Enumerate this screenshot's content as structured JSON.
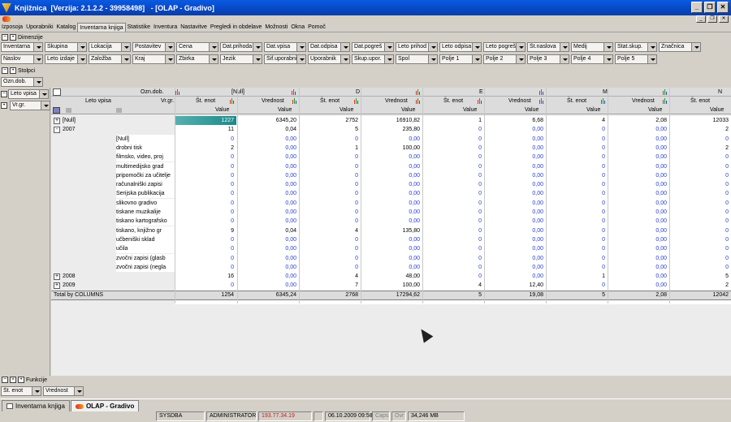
{
  "window": {
    "title": "Knjižnica  [Verzija: 2.1.2.2 - 39958498]   - [OLAP - Gradivo]"
  },
  "menu": [
    "Izposoja",
    "Uporabniki",
    "Katalog",
    "Inventarna knjiga",
    "Statistike",
    "Inventura",
    "Nastavitve",
    "Pregledi in obdelave",
    "Možnosti",
    "Okna",
    "Pomoč"
  ],
  "menu_active": 3,
  "sections": {
    "dimensions": "Dimenzije",
    "columns": "Stolpci",
    "functions": "Funkcije"
  },
  "dimension_row1": [
    "Inventarna",
    "Skupina",
    "Lokacija",
    "Postavitev",
    "Cena",
    "Dat.prihoda",
    "Dat.vpisa",
    "Dat.odpisa",
    "Dat.pogreš",
    "Leto prihod",
    "Leto odpisa",
    "Leto pogreš",
    "Št.naslova",
    "Medij",
    "Stat.skup.",
    "Značnica"
  ],
  "dimension_row2": [
    "Naslov",
    "Leto izdaje",
    "Založba",
    "Kraj",
    "Zbirka",
    "Jezik",
    "Šif.uporabni",
    "Uporabnik",
    "Skup.upor.",
    "Spol",
    "Polje 1",
    "Polje 2",
    "Polje 3",
    "Polje 4",
    "Polje 5"
  ],
  "column_field": "Ozn.dob.",
  "row_fields": [
    "Leto vpisa",
    "Vr.gr."
  ],
  "grid": {
    "col_dim_label": "Ozn.dob.",
    "row_head_1": "Leto vpisa",
    "row_head_2": "Vr.gr.",
    "groups": [
      "[Null]",
      "D",
      "E",
      "M",
      "N"
    ],
    "measures": [
      "Št. enot",
      "Vrednost"
    ],
    "value_label": "Value",
    "rows": [
      {
        "l1": "[Null]",
        "l2": "",
        "exp": "+",
        "v": [
          "1227",
          "6345,20",
          "2752",
          "16910,82",
          "1",
          "6,68",
          "4",
          "2,08",
          "12033"
        ]
      },
      {
        "l1": "2007",
        "l2": "",
        "exp": "-",
        "v": [
          "11",
          "0,04",
          "5",
          "235,80",
          "0",
          "0,00",
          "0",
          "0,00",
          "2"
        ]
      },
      {
        "l1": "",
        "l2": "[Null]",
        "v": [
          "0",
          "0,00",
          "0",
          "0,00",
          "0",
          "0,00",
          "0",
          "0,00",
          "0"
        ]
      },
      {
        "l1": "",
        "l2": "drobni tisk",
        "v": [
          "2",
          "0,00",
          "1",
          "100,00",
          "0",
          "0,00",
          "0",
          "0,00",
          "2"
        ]
      },
      {
        "l1": "",
        "l2": "filmsko, video, proj",
        "v": [
          "0",
          "0,00",
          "0",
          "0,00",
          "0",
          "0,00",
          "0",
          "0,00",
          "0"
        ]
      },
      {
        "l1": "",
        "l2": "multimedijsko grad",
        "v": [
          "0",
          "0,00",
          "0",
          "0,00",
          "0",
          "0,00",
          "0",
          "0,00",
          "0"
        ]
      },
      {
        "l1": "",
        "l2": "pripomočki za učitelje",
        "v": [
          "0",
          "0,00",
          "0",
          "0,00",
          "0",
          "0,00",
          "0",
          "0,00",
          "0"
        ]
      },
      {
        "l1": "",
        "l2": "računalniški zapisi",
        "v": [
          "0",
          "0,00",
          "0",
          "0,00",
          "0",
          "0,00",
          "0",
          "0,00",
          "0"
        ]
      },
      {
        "l1": "",
        "l2": "Serijska publikacija",
        "v": [
          "0",
          "0,00",
          "0",
          "0,00",
          "0",
          "0,00",
          "0",
          "0,00",
          "0"
        ]
      },
      {
        "l1": "",
        "l2": "slikovno gradivo",
        "v": [
          "0",
          "0,00",
          "0",
          "0,00",
          "0",
          "0,00",
          "0",
          "0,00",
          "0"
        ]
      },
      {
        "l1": "",
        "l2": "tiskane muzikalije",
        "v": [
          "0",
          "0,00",
          "0",
          "0,00",
          "0",
          "0,00",
          "0",
          "0,00",
          "0"
        ]
      },
      {
        "l1": "",
        "l2": "tiskano kartografsko",
        "v": [
          "0",
          "0,00",
          "0",
          "0,00",
          "0",
          "0,00",
          "0",
          "0,00",
          "0"
        ]
      },
      {
        "l1": "",
        "l2": "tiskano, knjižno gr",
        "v": [
          "9",
          "0,04",
          "4",
          "135,80",
          "0",
          "0,00",
          "0",
          "0,00",
          "0"
        ]
      },
      {
        "l1": "",
        "l2": "učbeniški sklad",
        "v": [
          "0",
          "0,00",
          "0",
          "0,00",
          "0",
          "0,00",
          "0",
          "0,00",
          "0"
        ]
      },
      {
        "l1": "",
        "l2": "učila",
        "v": [
          "0",
          "0,00",
          "0",
          "0,00",
          "0",
          "0,00",
          "0",
          "0,00",
          "0"
        ]
      },
      {
        "l1": "",
        "l2": "zvočni zapisi (glasb",
        "v": [
          "0",
          "0,00",
          "0",
          "0,00",
          "0",
          "0,00",
          "0",
          "0,00",
          "0"
        ]
      },
      {
        "l1": "",
        "l2": "zvočni zapisi (negla",
        "v": [
          "0",
          "0,00",
          "0",
          "0,00",
          "0",
          "0,00",
          "0",
          "0,00",
          "0"
        ]
      },
      {
        "l1": "2008",
        "l2": "",
        "exp": "+",
        "v": [
          "16",
          "0,00",
          "4",
          "48,00",
          "0",
          "0,00",
          "1",
          "0,00",
          "5"
        ]
      },
      {
        "l1": "2009",
        "l2": "",
        "exp": "+",
        "v": [
          "0",
          "0,00",
          "7",
          "100,00",
          "4",
          "12,40",
          "0",
          "0,00",
          "2"
        ]
      },
      {
        "l1": "Total by COLUMNS",
        "l2": "",
        "total": true,
        "v": [
          "1254",
          "6345,24",
          "2768",
          "17294,62",
          "5",
          "19,08",
          "5",
          "2,08",
          "12042"
        ]
      }
    ]
  },
  "functions": [
    "Št. enot",
    "Vrednost"
  ],
  "taskbar": [
    "Inventarna knjiga",
    "OLAP - Gradivo"
  ],
  "status": [
    "SYSDBA",
    "ADMINISTRATOR",
    "193.77.34.19",
    "06.10.2009 09:58",
    "Caps",
    "Ovr",
    "34,246 MB"
  ],
  "colors": {
    "title": "#0848c8",
    "zero": "#2a3fd0",
    "highlight": "#2a9a9a",
    "ip": "#c02020"
  }
}
